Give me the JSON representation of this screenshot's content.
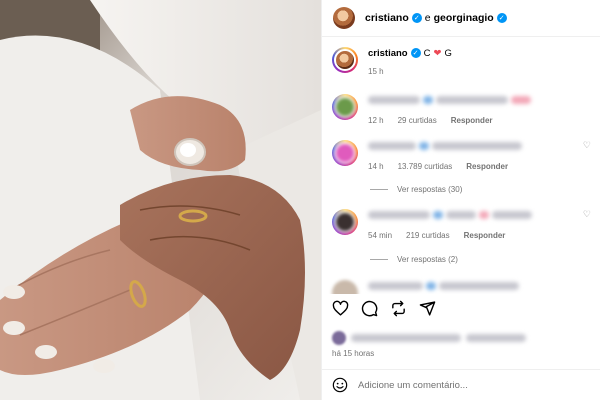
{
  "header": {
    "user1": "cristiano",
    "connector": "e",
    "user2": "georginagio"
  },
  "caption": {
    "username": "cristiano",
    "text_before": "C",
    "heart": "❤",
    "text_after": "G",
    "time": "15 h"
  },
  "comments": [
    {
      "time": "12 h",
      "likes": "29 curtidas",
      "reply": "Responder"
    },
    {
      "time": "14 h",
      "likes": "13.789 curtidas",
      "reply": "Responder",
      "view_replies": "Ver respostas (30)"
    },
    {
      "time": "54 min",
      "likes": "219 curtidas",
      "reply": "Responder",
      "view_replies": "Ver respostas (2)"
    }
  ],
  "footer": {
    "posted": "há 15 horas",
    "add_comment_placeholder": "Adicione um comentário..."
  },
  "icons": [
    "heart-icon",
    "comment-icon",
    "repost-icon",
    "share-icon",
    "emoji-icon",
    "verified-icon"
  ],
  "colors": {
    "verified": "#0095f6",
    "heart": "#ed4956",
    "muted": "#737373"
  }
}
